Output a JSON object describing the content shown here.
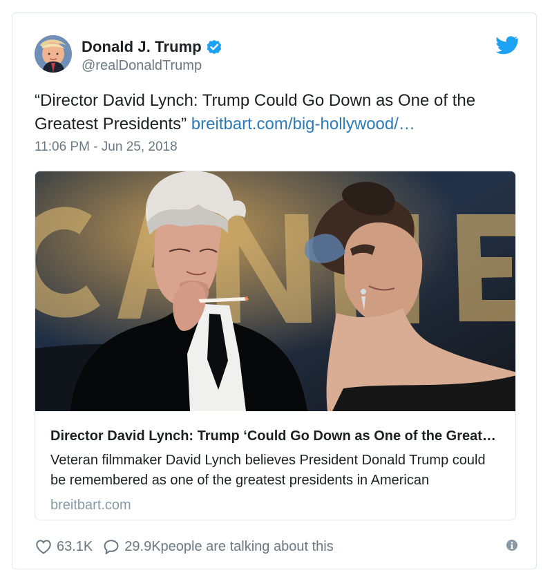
{
  "author": {
    "display_name": "Donald J. Trump",
    "handle": "@realDonaldTrump",
    "avatar_icon": "profile-avatar",
    "verified_icon": "verified-badge-icon"
  },
  "tweet": {
    "text": "“Director David Lynch: Trump Could Go Down as One of the Greatest Presidents” ",
    "link": "breitbart.com/big-hollywood/…",
    "timestamp": "11:06 PM - Jun 25, 2018"
  },
  "card": {
    "image_icon": "article-photo",
    "title": "Director David Lynch: Trump ‘Could Go Down as One of the Greate…",
    "description": "Veteran filmmaker David Lynch believes President Donald Trump could be remembered as one of the greatest presidents in American",
    "domain": "breitbart.com"
  },
  "actions": {
    "likes": "63.1K",
    "talking_count": "29.9K",
    "talking_text": " people are talking about this",
    "like_icon": "heart-icon",
    "reply_icon": "speech-bubble-icon",
    "info_icon": "info-icon"
  },
  "colors": {
    "link": "#2b7bb9",
    "twitter_blue": "#1da1f2",
    "muted": "#697882",
    "border": "#e1e8ed"
  }
}
